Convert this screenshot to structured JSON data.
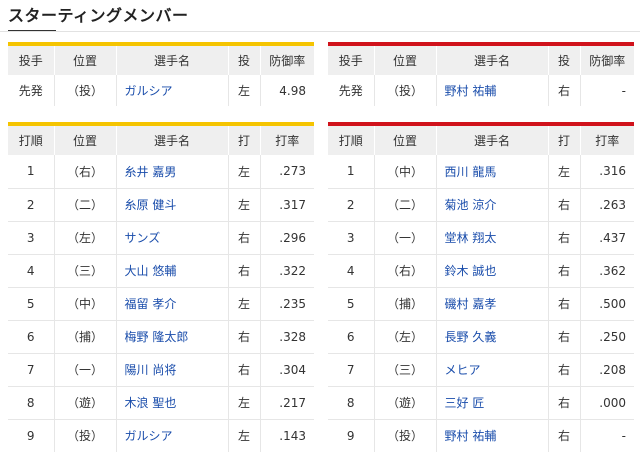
{
  "section_title": "スターティングメンバー",
  "colors": {
    "home_accent": "#f5c400",
    "away_accent": "#d0121b",
    "player_link": "#1a4dab"
  },
  "pitchers": {
    "headers": [
      "投手",
      "位置",
      "選手名",
      "投",
      "防御率"
    ],
    "left": {
      "role": "先発",
      "pos": "（投）",
      "name": "ガルシア",
      "throws": "左",
      "era": "4.98"
    },
    "right": {
      "role": "先発",
      "pos": "（投）",
      "name": "野村 祐輔",
      "throws": "右",
      "era": "-"
    }
  },
  "lineup": {
    "headers": [
      "打順",
      "位置",
      "選手名",
      "打",
      "打率"
    ],
    "left": [
      {
        "order": "1",
        "pos": "（右）",
        "name": "糸井 嘉男",
        "bats": "左",
        "avg": ".273"
      },
      {
        "order": "2",
        "pos": "（二）",
        "name": "糸原 健斗",
        "bats": "左",
        "avg": ".317"
      },
      {
        "order": "3",
        "pos": "（左）",
        "name": "サンズ",
        "bats": "右",
        "avg": ".296"
      },
      {
        "order": "4",
        "pos": "（三）",
        "name": "大山 悠輔",
        "bats": "右",
        "avg": ".322"
      },
      {
        "order": "5",
        "pos": "（中）",
        "name": "福留 孝介",
        "bats": "左",
        "avg": ".235"
      },
      {
        "order": "6",
        "pos": "（捕）",
        "name": "梅野 隆太郎",
        "bats": "右",
        "avg": ".328"
      },
      {
        "order": "7",
        "pos": "（一）",
        "name": "陽川 尚将",
        "bats": "右",
        "avg": ".304"
      },
      {
        "order": "8",
        "pos": "（遊）",
        "name": "木浪 聖也",
        "bats": "左",
        "avg": ".217"
      },
      {
        "order": "9",
        "pos": "（投）",
        "name": "ガルシア",
        "bats": "左",
        "avg": ".143"
      }
    ],
    "right": [
      {
        "order": "1",
        "pos": "（中）",
        "name": "西川 龍馬",
        "bats": "左",
        "avg": ".316"
      },
      {
        "order": "2",
        "pos": "（二）",
        "name": "菊池 涼介",
        "bats": "右",
        "avg": ".263"
      },
      {
        "order": "3",
        "pos": "（一）",
        "name": "堂林 翔太",
        "bats": "右",
        "avg": ".437"
      },
      {
        "order": "4",
        "pos": "（右）",
        "name": "鈴木 誠也",
        "bats": "右",
        "avg": ".362"
      },
      {
        "order": "5",
        "pos": "（捕）",
        "name": "磯村 嘉孝",
        "bats": "右",
        "avg": ".500"
      },
      {
        "order": "6",
        "pos": "（左）",
        "name": "長野 久義",
        "bats": "右",
        "avg": ".250"
      },
      {
        "order": "7",
        "pos": "（三）",
        "name": "メヒア",
        "bats": "右",
        "avg": ".208"
      },
      {
        "order": "8",
        "pos": "（遊）",
        "name": "三好 匠",
        "bats": "右",
        "avg": ".000"
      },
      {
        "order": "9",
        "pos": "（投）",
        "name": "野村 祐輔",
        "bats": "右",
        "avg": "-"
      }
    ]
  }
}
